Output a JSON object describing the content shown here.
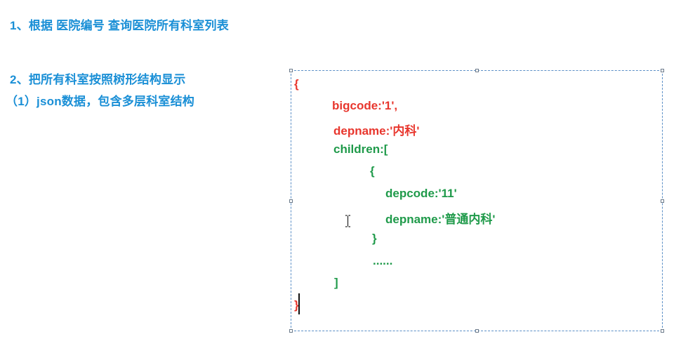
{
  "headings": {
    "line1": "1、根据 医院编号 查询医院所有科室列表",
    "line2": "2、把所有科室按照树形结构显示",
    "line3": "（1）json数据，包含多层科室结构"
  },
  "code": {
    "open_brace": "{",
    "bigcode": "bigcode:'1',",
    "depname": "depname:'内科'",
    "children_open": "children:[",
    "inner_open": "{",
    "depcode": "depcode:'11'",
    "inner_depname": "depname:'普通内科'",
    "inner_close": "}",
    "ellipsis": "......",
    "children_close": "]",
    "close_brace": "}"
  },
  "colors": {
    "heading": "#1a8fd6",
    "code_red": "#e8362d",
    "code_green": "#1f9a4a",
    "textbox_border": "#5b8fc7"
  }
}
